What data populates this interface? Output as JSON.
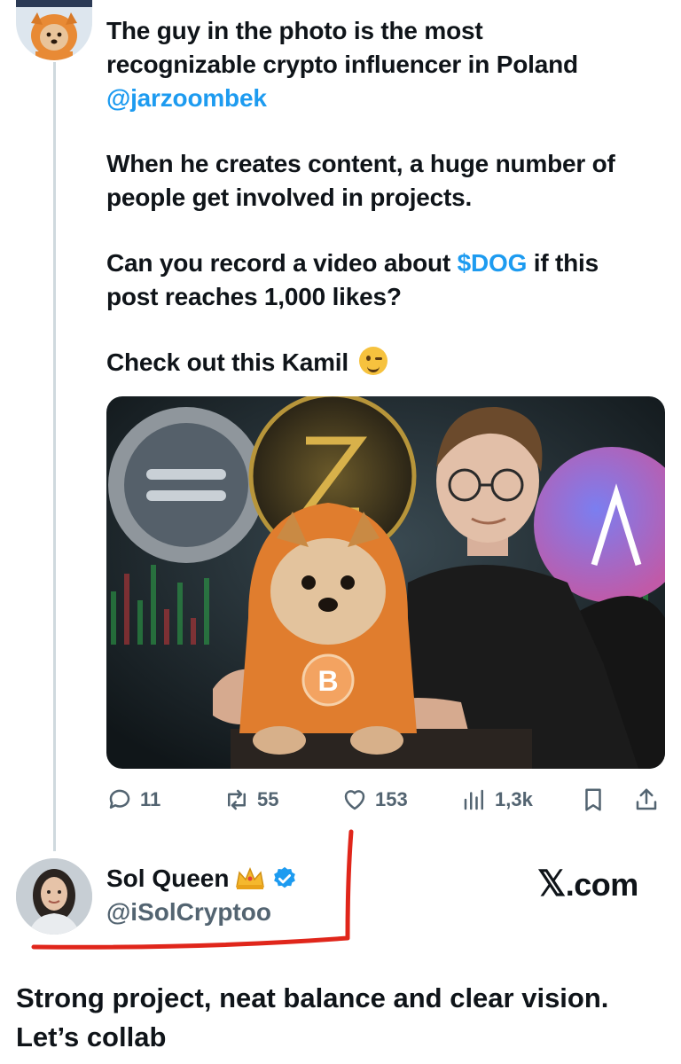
{
  "tweet": {
    "line1": "The guy in the photo is the most",
    "line2": "recognizable crypto influencer in Poland",
    "mention": "@jarzoombek",
    "para2_line1": "When he creates content, a huge number of",
    "para2_line2": "people get involved in projects.",
    "para3_part1": "Can you record a video about ",
    "para3_cashtag": "$DOG",
    "para3_part2": " if this",
    "para3_line2": "post reaches 1,000 likes?",
    "para4": "Check out this Kamil",
    "emoji": "wink-emoji"
  },
  "actions": {
    "replies": "11",
    "reposts": "55",
    "likes": "153",
    "views": "1,3k"
  },
  "user": {
    "name": "Sol Queen",
    "handle": "@iSolCryptoo",
    "verified": true
  },
  "watermark": "X.com",
  "watermark_logo": "𝕏",
  "watermark_suffix": ".com",
  "reply": {
    "line1": "Strong project, neat balance and clear vision.",
    "line2": "Let’s collab"
  },
  "colors": {
    "link": "#1d9bf0",
    "muted": "#536471",
    "annotation": "#e0261b"
  }
}
